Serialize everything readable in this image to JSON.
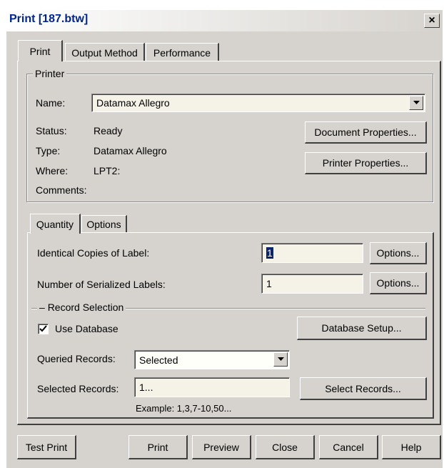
{
  "window": {
    "title": "Print [187.btw]",
    "close_glyph": "×"
  },
  "tabs": [
    "Print",
    "Output Method",
    "Performance"
  ],
  "printer": {
    "group_label": "Printer",
    "name_label": "Name:",
    "name_value": "Datamax Allegro",
    "status_label": "Status:",
    "status_value": "Ready",
    "type_label": "Type:",
    "type_value": "Datamax Allegro",
    "where_label": "Where:",
    "where_value": "LPT2:",
    "comments_label": "Comments:",
    "document_properties_button": "Document Properties...",
    "printer_properties_button": "Printer Properties..."
  },
  "subtabs": [
    "Quantity",
    "Options"
  ],
  "quantity": {
    "identical_copies_label": "Identical Copies of Label:",
    "identical_copies_value": "1",
    "serialized_labels_label": "Number of Serialized Labels:",
    "serialized_labels_value": "1",
    "options_button": "Options...",
    "record_selection_label": "Record Selection",
    "use_database_label": "Use Database",
    "use_database_checked": true,
    "database_setup_button": "Database Setup...",
    "queried_records_label": "Queried Records:",
    "queried_records_value": "Selected",
    "selected_records_label": "Selected Records:",
    "selected_records_value": "1...",
    "select_records_button": "Select Records...",
    "example_text": "Example: 1,3,7-10,50..."
  },
  "footer": {
    "test_print": "Test Print",
    "print": "Print",
    "preview": "Preview",
    "close": "Close",
    "cancel": "Cancel",
    "help": "Help"
  }
}
